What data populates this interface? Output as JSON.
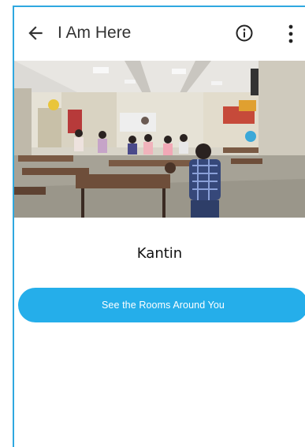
{
  "app_bar": {
    "title": "I Am Here",
    "back_icon": "arrow-left-icon",
    "info_icon": "info-circle-icon",
    "menu_icon": "more-vertical-icon"
  },
  "location": {
    "name": "Kantin",
    "photo_description_icon": "canteen-photo"
  },
  "actions": {
    "rooms_button_label": "See the Rooms Around You"
  },
  "colors": {
    "accent": "#25aeea",
    "frame_border": "#2fa8e0",
    "title_text": "#333333"
  }
}
